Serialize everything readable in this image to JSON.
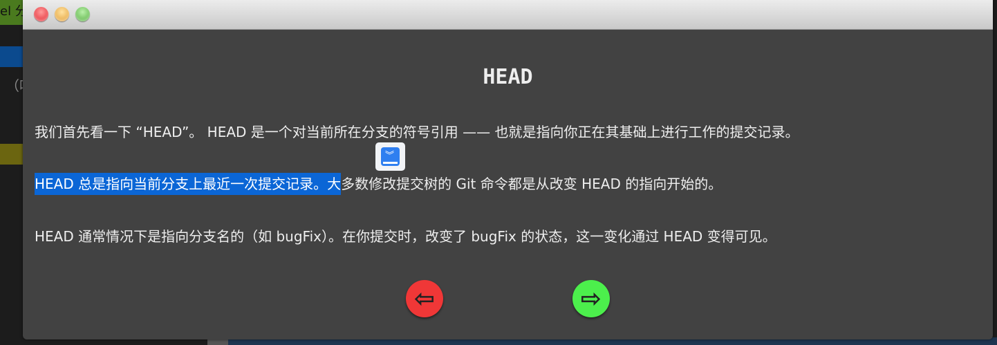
{
  "background": {
    "partial_text_top": "el 分",
    "partial_text_left": "（吡"
  },
  "window": {
    "controls": [
      "close",
      "minimize",
      "maximize"
    ]
  },
  "dialog": {
    "title": "HEAD",
    "paragraphs": [
      "我们首先看一下 “HEAD”。 HEAD 是一个对当前所在分支的符号引用 —— 也就是指向你正在其基础上进行工作的提交记录。",
      {
        "selected": "HEAD 总是指向当前分支上最近一次提交记录。大",
        "rest": "多数修改提交树的 Git 命令都是从改变 HEAD 的指向开始的。"
      },
      "HEAD 通常情况下是指向分支名的（如 bugFix）。在你提交时，改变了 bugFix 的状态，这一变化通过 HEAD 变得可见。"
    ],
    "prev_icon": "arrow-left-icon",
    "next_icon": "arrow-right-icon",
    "colors": {
      "prev": "#f03737",
      "next": "#4cef4c",
      "selection": "#0b66d6"
    }
  }
}
